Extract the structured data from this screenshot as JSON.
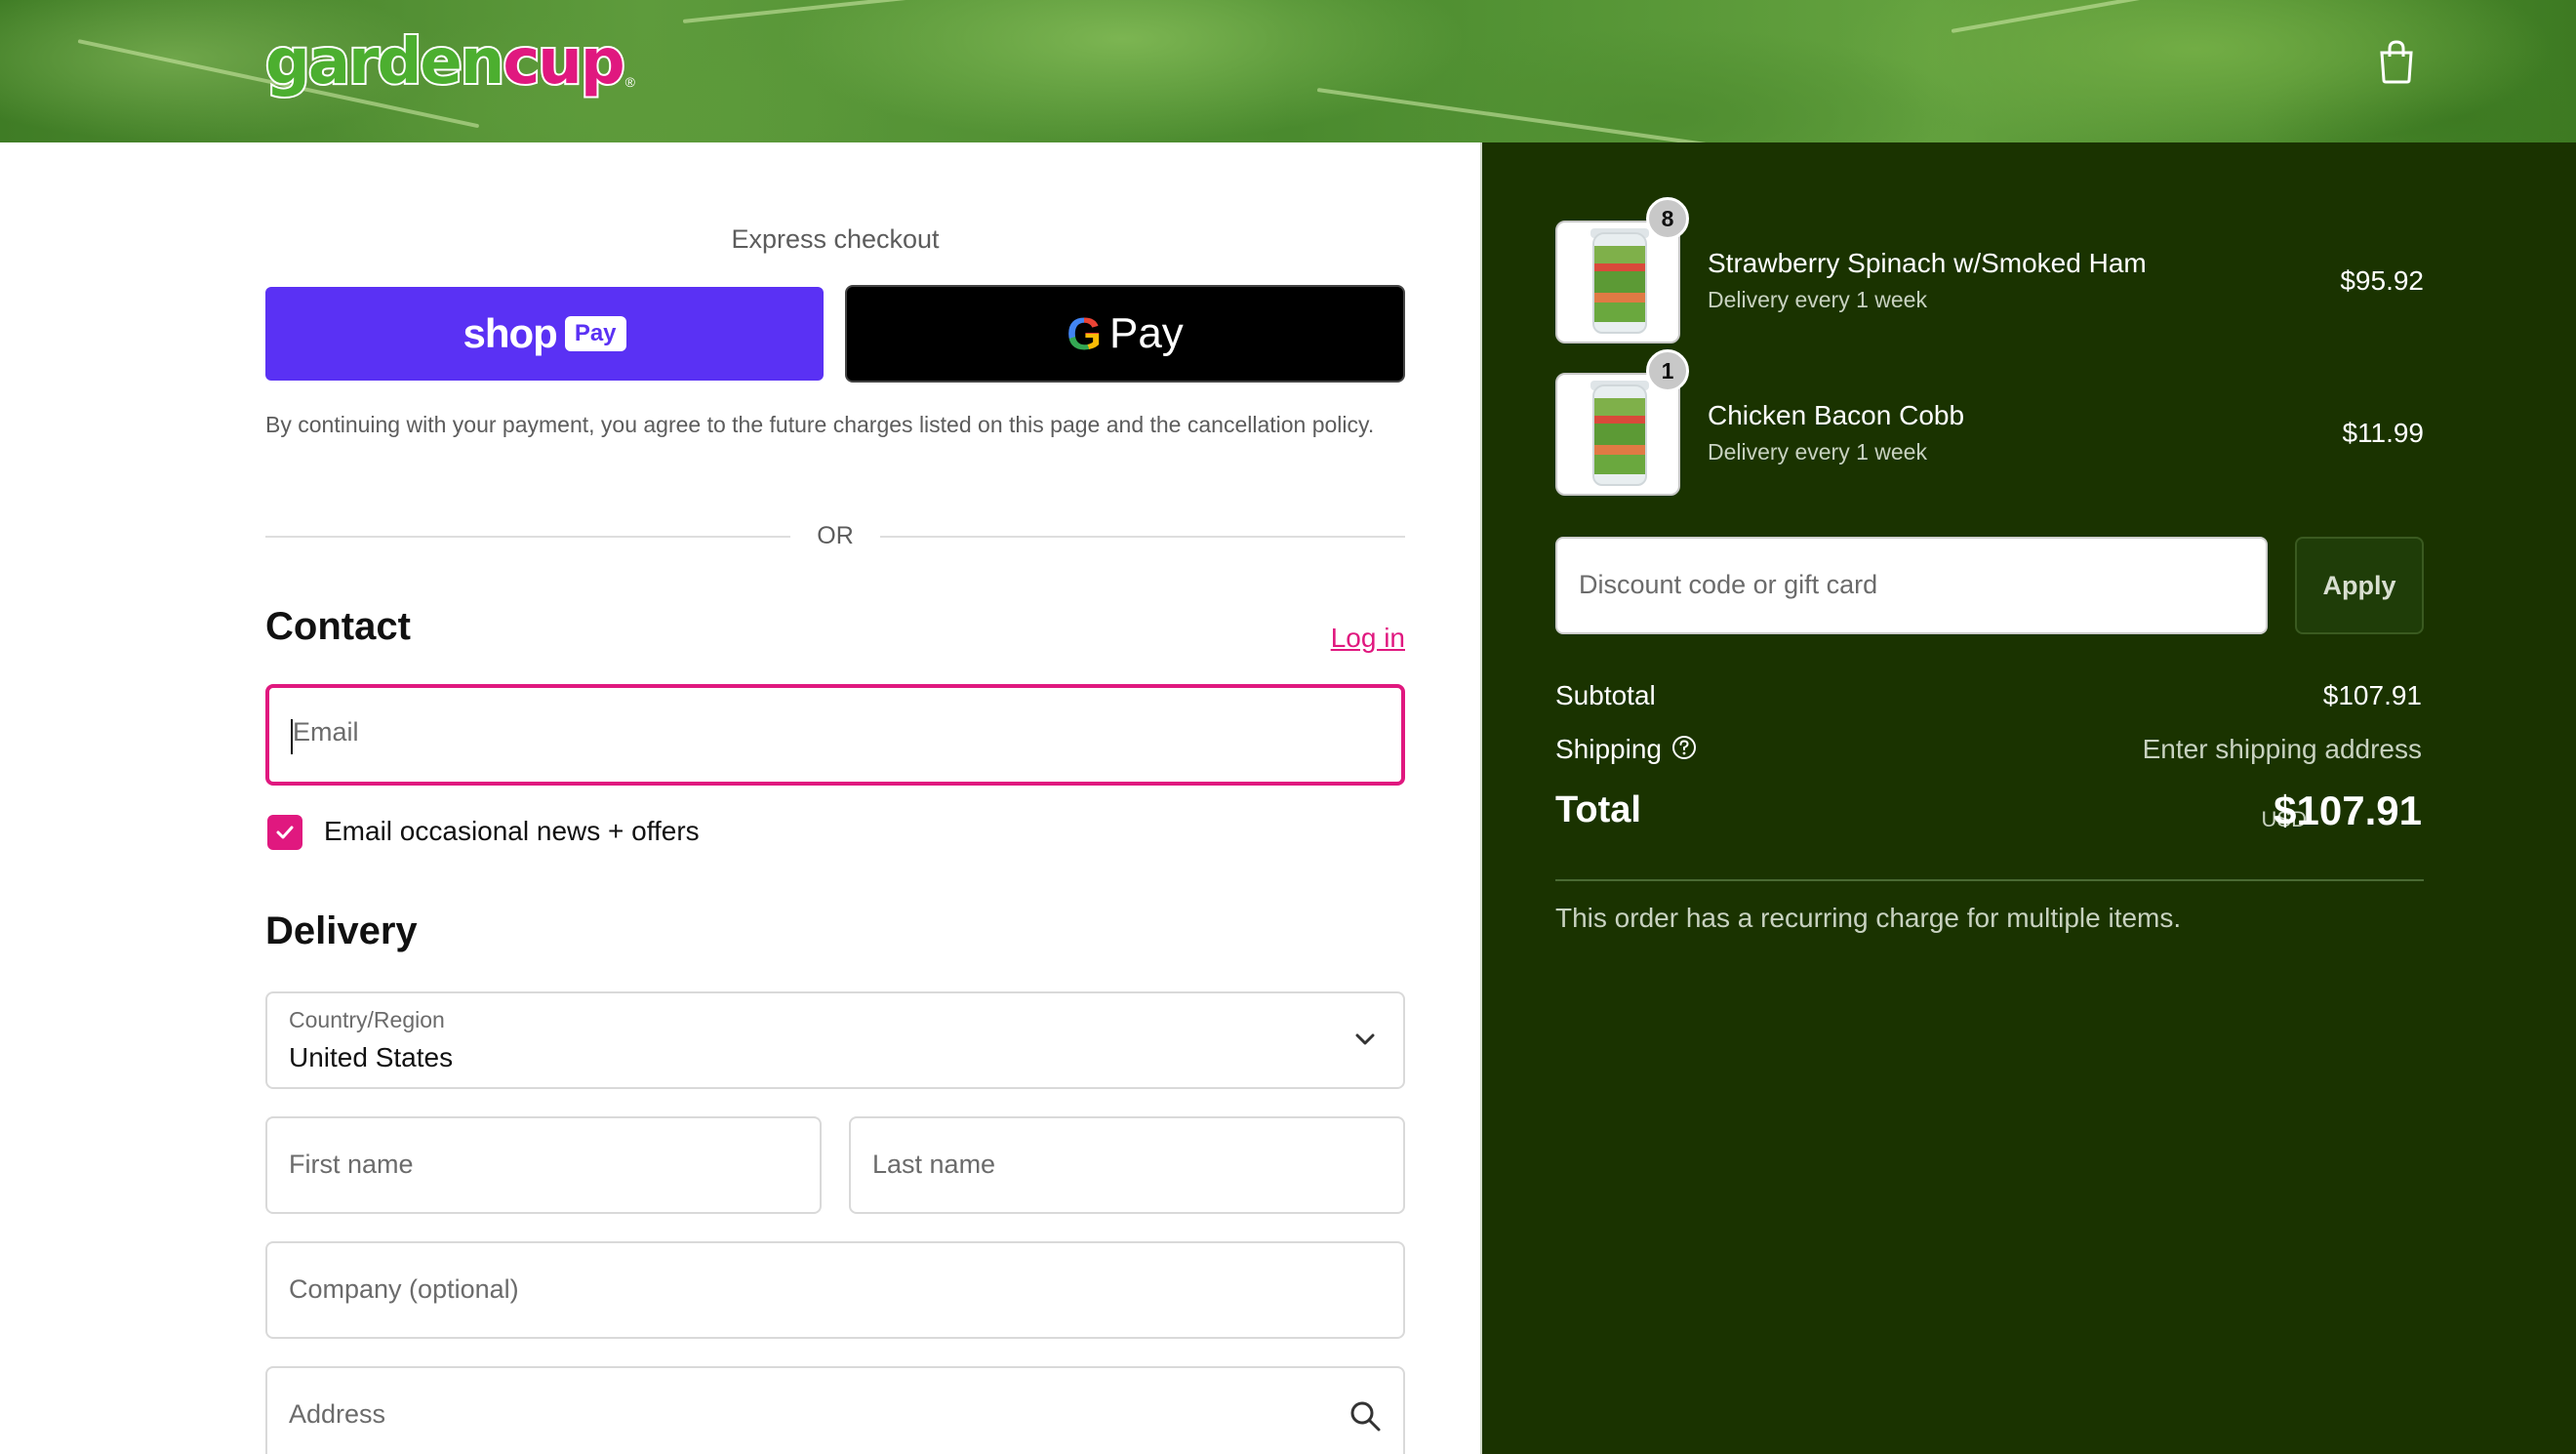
{
  "header": {
    "logo_text_left": "garden",
    "logo_text_right": "cup",
    "logo_mark": "®",
    "cart_icon": "shopping-bag-icon"
  },
  "express": {
    "title": "Express checkout",
    "shoppay_label": "shop",
    "shoppay_badge": "Pay",
    "gpay_g": "G",
    "gpay_label": "Pay",
    "legal": "By continuing with your payment, you agree to the future charges listed on this page and the cancellation policy.",
    "or": "OR"
  },
  "contact": {
    "title": "Contact",
    "login": "Log in",
    "email_placeholder": "Email",
    "newsletter_label": "Email occasional news + offers",
    "newsletter_checked": true
  },
  "delivery": {
    "title": "Delivery",
    "country_label": "Country/Region",
    "country_value": "United States",
    "first_name_placeholder": "First name",
    "last_name_placeholder": "Last name",
    "company_placeholder": "Company (optional)",
    "address_placeholder": "Address"
  },
  "summary": {
    "items": [
      {
        "qty": "8",
        "name": "Strawberry Spinach w/Smoked Ham",
        "subtitle": "Delivery every 1 week",
        "price": "$95.92"
      },
      {
        "qty": "1",
        "name": "Chicken Bacon Cobb",
        "subtitle": "Delivery every 1 week",
        "price": "$11.99"
      }
    ],
    "discount_placeholder": "Discount code or gift card",
    "apply_label": "Apply",
    "subtotal_label": "Subtotal",
    "subtotal_value": "$107.91",
    "shipping_label": "Shipping",
    "shipping_value": "Enter shipping address",
    "total_label": "Total",
    "total_currency": "USD",
    "total_value": "$107.91",
    "recurring_note": "This order has a recurring charge for multiple items."
  },
  "colors": {
    "brand_pink": "#e0187f",
    "shoppay_purple": "#5a31f4",
    "summary_bg": "#1a3300"
  }
}
